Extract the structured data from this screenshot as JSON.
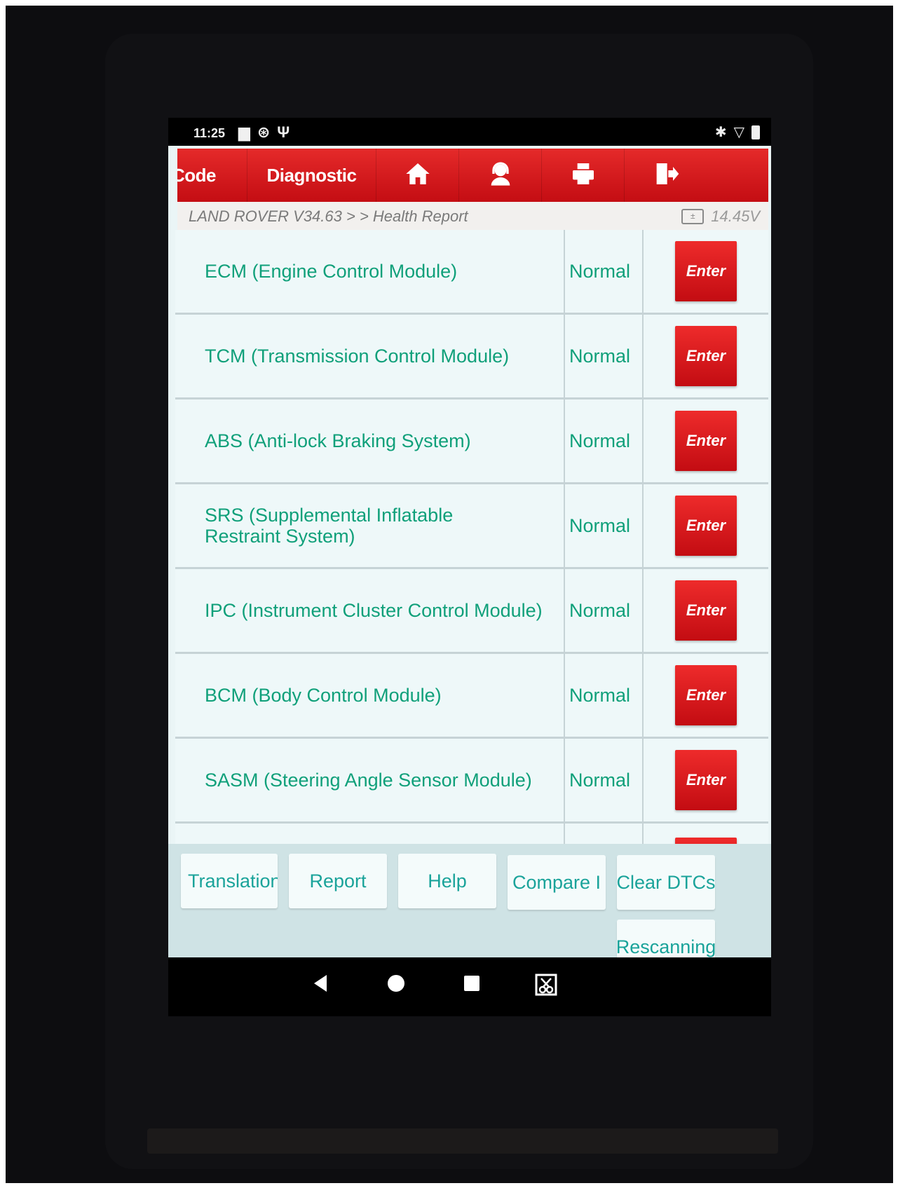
{
  "status_bar": {
    "time": "11:25",
    "left_icons": [
      "image-icon",
      "steering-icon",
      "usb-icon"
    ],
    "right_icons": [
      "bluetooth-icon",
      "wifi-icon",
      "battery-icon"
    ]
  },
  "toolbar": {
    "code_label": "Code",
    "diagnostic_label": "Diagnostic",
    "icons": [
      "home-icon",
      "support-icon",
      "print-icon",
      "exit-icon"
    ],
    "accent_color": "#d61c20"
  },
  "breadcrumb": {
    "path": "LAND ROVER V34.63 >  > Health Report",
    "voltage": "14.45V",
    "voltage_icon": "battery-gauge-icon"
  },
  "modules": [
    {
      "name": "ECM (Engine Control Module)",
      "status": "Normal",
      "action": "Enter"
    },
    {
      "name": "TCM (Transmission Control Module)",
      "status": "Normal",
      "action": "Enter"
    },
    {
      "name": "ABS (Anti-lock Braking System)",
      "status": "Normal",
      "action": "Enter"
    },
    {
      "name": "SRS (Supplemental Inflatable Restraint System)",
      "status": "Normal",
      "action": "Enter"
    },
    {
      "name": "IPC (Instrument Cluster Control Module)",
      "status": "Normal",
      "action": "Enter"
    },
    {
      "name": "BCM (Body Control Module)",
      "status": "Normal",
      "action": "Enter"
    },
    {
      "name": "SASM (Steering Angle Sensor Module)",
      "status": "Normal",
      "action": "Enter"
    }
  ],
  "footer": {
    "translation": "Translation",
    "report": "Report",
    "help": "Help",
    "compare": "Compare I",
    "clear_dtcs": "Clear DTCs",
    "rescanning": "Rescanning"
  },
  "navbar": {
    "icons": [
      "back-icon",
      "home-circle-icon",
      "recents-icon",
      "screenshot-icon"
    ]
  }
}
